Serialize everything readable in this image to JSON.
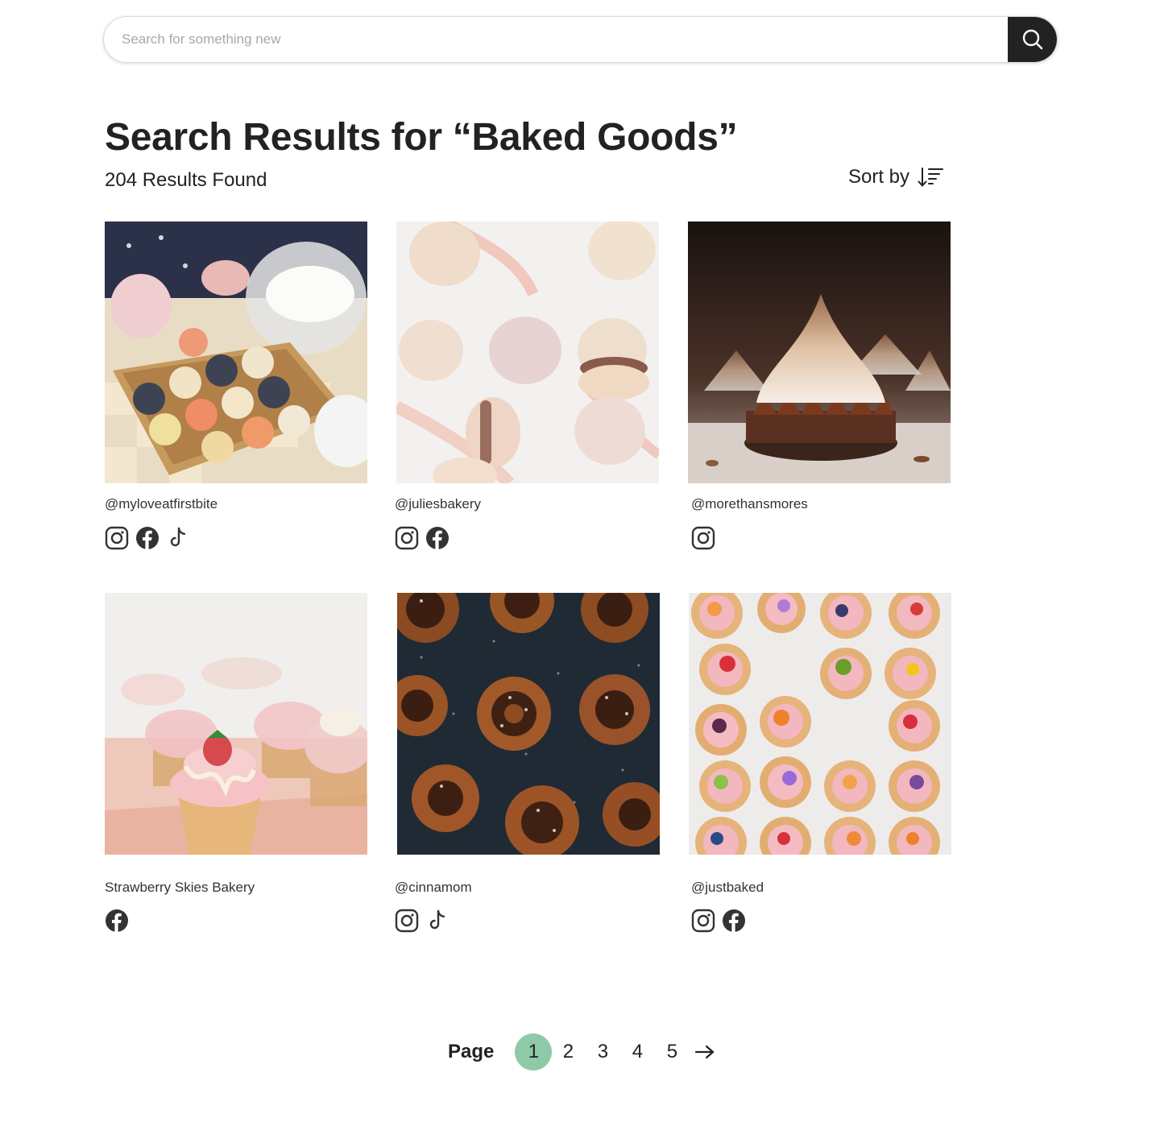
{
  "search": {
    "placeholder": "Search for something new",
    "value": ""
  },
  "results": {
    "title": "Search Results for “Baked Goods”",
    "count_text": "204 Results Found",
    "sort_label": "Sort by"
  },
  "cards": [
    {
      "handle": "@myloveatfirstbite",
      "image": "macarons-tea-party",
      "socials": [
        "instagram-icon",
        "facebook-icon",
        "tiktok-icon"
      ]
    },
    {
      "handle": "@juliesbakery",
      "image": "pastel-macarons",
      "socials": [
        "instagram-icon",
        "facebook-icon"
      ]
    },
    {
      "handle": "@morethansmores",
      "image": "meringue-tarts",
      "socials": [
        "instagram-icon"
      ]
    },
    {
      "handle": "Strawberry Skies Bakery",
      "image": "strawberry-cupcakes",
      "socials": [
        "facebook-icon"
      ]
    },
    {
      "handle": "@cinnamom",
      "image": "cinnamon-rolls",
      "socials": [
        "instagram-icon",
        "tiktok-icon"
      ]
    },
    {
      "handle": "@justbaked",
      "image": "fruit-tarts",
      "socials": [
        "instagram-icon",
        "facebook-icon"
      ]
    }
  ],
  "pagination": {
    "label": "Page",
    "pages": [
      "1",
      "2",
      "3",
      "4",
      "5"
    ],
    "current": "1"
  },
  "colors": {
    "accent": "#8fcaa8",
    "dark": "#222222"
  }
}
